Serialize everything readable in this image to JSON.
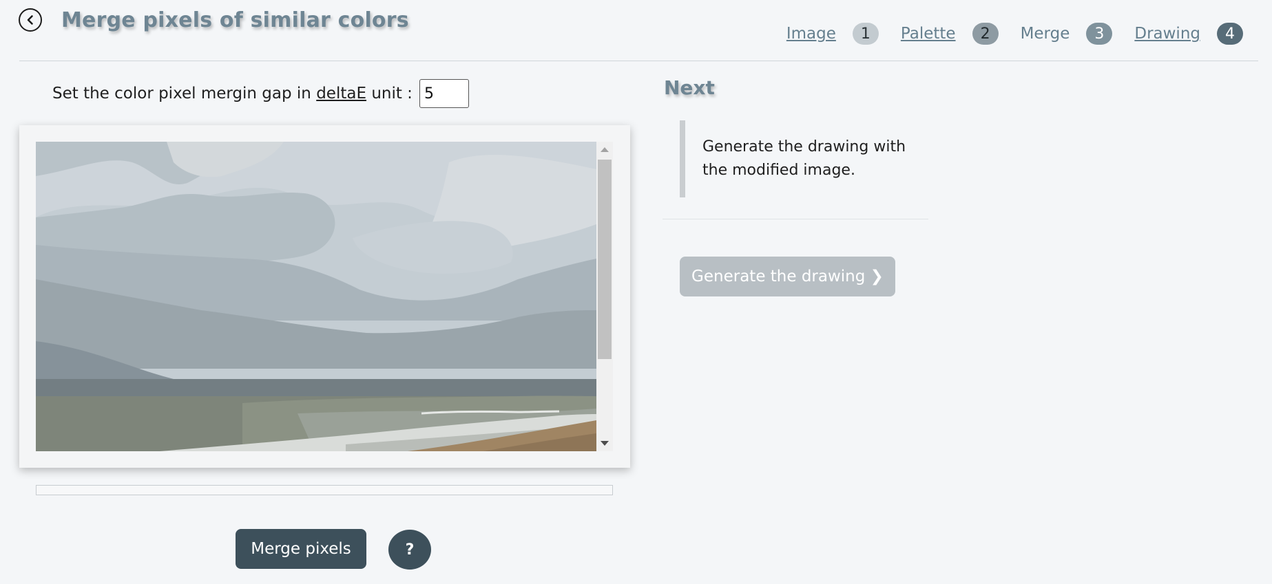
{
  "header": {
    "title": "Merge pixels of similar colors",
    "steps": [
      {
        "label": "Image",
        "number": "1",
        "link": true
      },
      {
        "label": "Palette",
        "number": "2",
        "link": true
      },
      {
        "label": "Merge",
        "number": "3",
        "link": false
      },
      {
        "label": "Drawing",
        "number": "4",
        "link": true
      }
    ]
  },
  "merge": {
    "gap_label_before": "Set the color pixel mergin gap in",
    "gap_link": "deltaE",
    "gap_label_after": "unit :",
    "gap_value": "5",
    "merge_button": "Merge pixels",
    "help_button": "?"
  },
  "next": {
    "heading": "Next",
    "description": "Generate the drawing with the modified image.",
    "generate_button": "Generate the drawing ❯"
  },
  "colors": {
    "title": "#6e8593",
    "button_dark": "#3d505b",
    "button_disabled": "#b8bfc4",
    "sand": "#a08563"
  }
}
